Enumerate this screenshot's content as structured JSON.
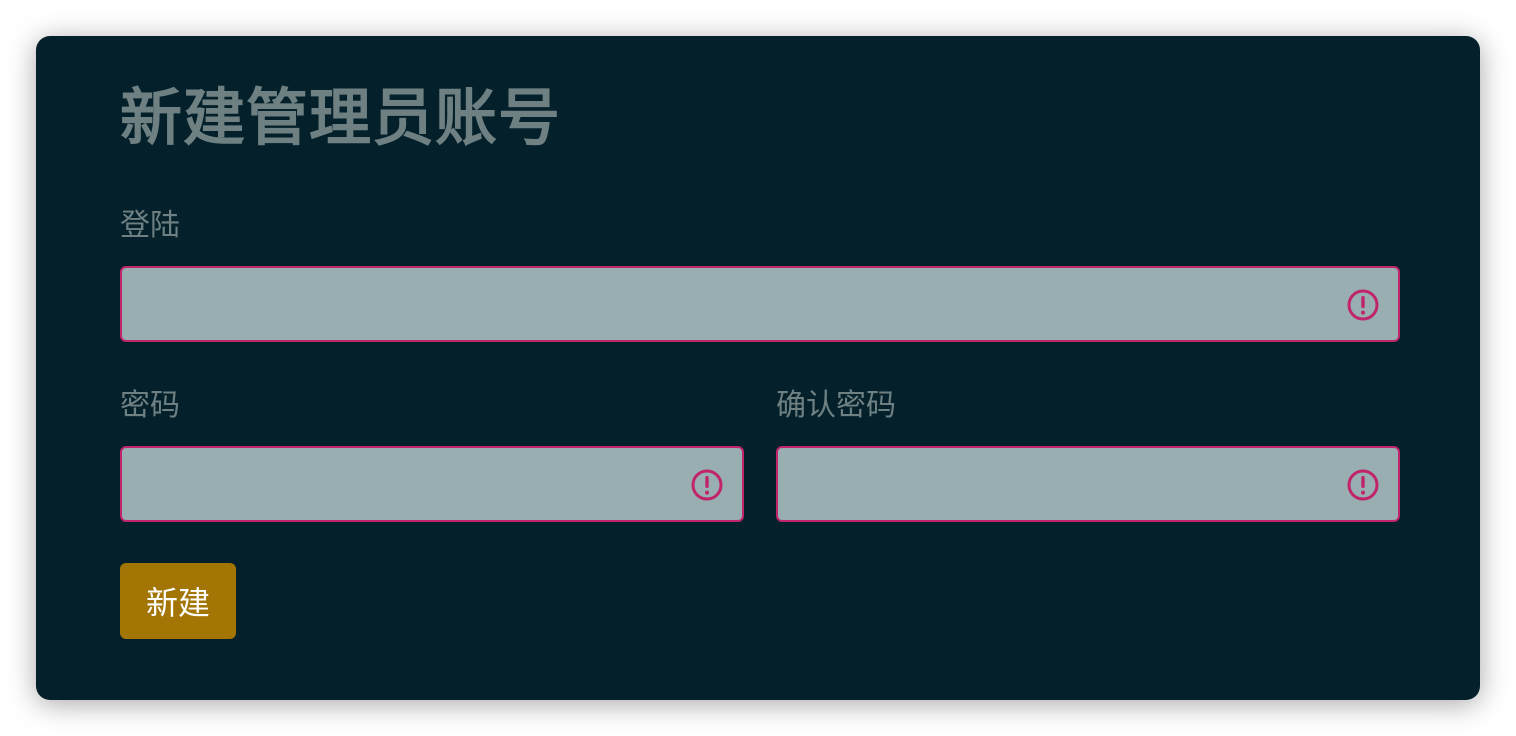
{
  "form": {
    "title": "新建管理员账号",
    "login_label": "登陆",
    "login_value": "",
    "password_label": "密码",
    "password_value": "",
    "confirm_password_label": "确认密码",
    "confirm_password_value": "",
    "submit_label": "新建"
  },
  "colors": {
    "panel_background": "#04202b",
    "label_text": "#6e8081",
    "input_background": "#99aeb1",
    "error_border": "#c0246a",
    "submit_button": "#a37505"
  },
  "icons": {
    "field_state": "alert-circle-icon"
  }
}
